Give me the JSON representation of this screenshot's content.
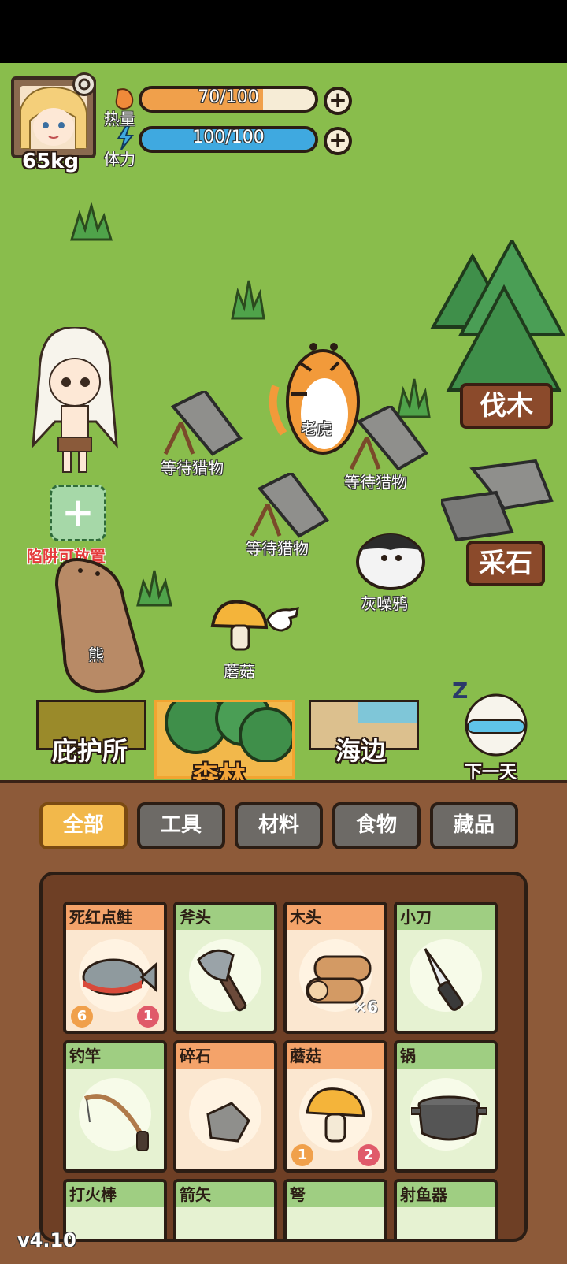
{
  "player": {
    "weight": "65kg"
  },
  "stats": {
    "heat": {
      "label": "热量",
      "value_text": "70/100",
      "fraction": 0.7,
      "color": "#f0a04b"
    },
    "stamina": {
      "label": "体力",
      "value_text": "100/100",
      "fraction": 1.0,
      "color": "#3fa9e0"
    }
  },
  "map": {
    "trap_labels": [
      "等待猎物",
      "等待猎物",
      "等待猎物"
    ],
    "animals": {
      "tiger": "老虎",
      "crow": "灰噪鸦",
      "bear": "熊",
      "mushroom": "蘑菇"
    },
    "trap_slot_label": "陷阱可放置",
    "signs": {
      "chop": "伐木",
      "quarry": "采石"
    },
    "next_day": "下一天"
  },
  "locations": [
    {
      "label": "庇护所"
    },
    {
      "label": "森林"
    },
    {
      "label": "海边"
    }
  ],
  "tabs": [
    "全部",
    "工具",
    "材料",
    "食物",
    "藏品"
  ],
  "inventory": [
    {
      "name": "死红点鲑",
      "icon": "fish-icon",
      "heat_badge": "6",
      "count_badge": "1"
    },
    {
      "name": "斧头",
      "icon": "axe-icon"
    },
    {
      "name": "木头",
      "icon": "log-icon",
      "qty": "×6"
    },
    {
      "name": "小刀",
      "icon": "knife-icon"
    },
    {
      "name": "钓竿",
      "icon": "fishing-rod-icon"
    },
    {
      "name": "碎石",
      "icon": "stone-icon"
    },
    {
      "name": "蘑菇",
      "icon": "mushroom-icon",
      "heat_badge": "1",
      "count_badge": "2"
    },
    {
      "name": "锅",
      "icon": "pot-icon"
    },
    {
      "name": "打火棒",
      "icon": "firestarter-icon"
    },
    {
      "name": "箭矢",
      "icon": "arrow-icon"
    },
    {
      "name": "弩",
      "icon": "crossbow-icon"
    },
    {
      "name": "射鱼器",
      "icon": "fish-gun-icon"
    }
  ],
  "version": "v4.10",
  "colors": {
    "grass": "#89bd4c",
    "accent": "#f2b84b",
    "wood": "#8d5a39"
  }
}
